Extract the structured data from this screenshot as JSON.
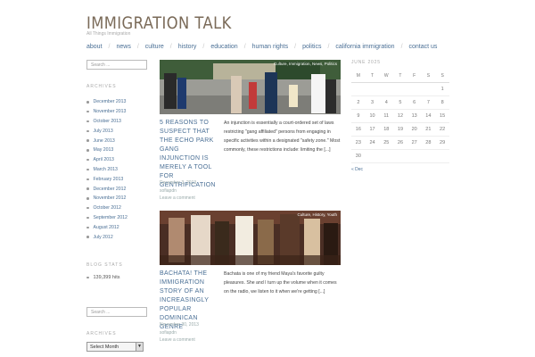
{
  "site": {
    "title": "IMMIGRATION TALK",
    "tagline": "All Things Immigration"
  },
  "nav": [
    "about",
    "news",
    "culture",
    "history",
    "education",
    "human rights",
    "politics",
    "california immigration",
    "contact us"
  ],
  "sidebar": {
    "search_placeholder": "Search ...",
    "archives_title": "ARCHIVES",
    "archives": [
      "December 2013",
      "November 2013",
      "October 2013",
      "July 2013",
      "June 2013",
      "May 2013",
      "April 2013",
      "March 2013",
      "February 2013",
      "December 2012",
      "November 2012",
      "October 2012",
      "September 2012",
      "August 2012",
      "July 2012"
    ],
    "blog_stats_title": "BLOG STATS",
    "hits": "139,399 hits",
    "search2_placeholder": "Search ...",
    "archives2_title": "ARCHIVES",
    "month_select": "Select Month"
  },
  "posts": [
    {
      "image_tags": "Culture, Immigration, News, Politics",
      "title": "5 REASONS TO SUSPECT THAT THE ECHO PARK GANG INJUNCTION IS MERELY A TOOL FOR GENTRIFICATION",
      "date": "December 3, 2013",
      "author": "sofiapdn",
      "comment": "Leave a comment",
      "excerpt": "An injunction is essentially a court-ordered set of laws restricting \"gang affiliated\" persons from engaging in specific activities within a designated \"safety zone.\" Most commonly, these restrictions include: limiting the [...]"
    },
    {
      "image_tags": "Culture, History, Youth",
      "title": "BACHATA! THE IMMIGRATION STORY OF AN INCREASINGLY POPULAR DOMINICAN GENRE",
      "date": "November 30, 2013",
      "author": "sofiapdn",
      "comment": "Leave a comment",
      "excerpt": "Bachata is one of my friend Maya's favorite guilty pleasures. She and I turn up the volume when it comes on the radio, we listen to it when we're getting [...]"
    }
  ],
  "calendar": {
    "caption": "JUNE 2025",
    "days": [
      "M",
      "T",
      "W",
      "T",
      "F",
      "S",
      "S"
    ],
    "weeks": [
      [
        "",
        "",
        "",
        "",
        "",
        "",
        "1"
      ],
      [
        "2",
        "3",
        "4",
        "5",
        "6",
        "7",
        "8"
      ],
      [
        "9",
        "10",
        "11",
        "12",
        "13",
        "14",
        "15"
      ],
      [
        "16",
        "17",
        "18",
        "19",
        "20",
        "21",
        "22"
      ],
      [
        "23",
        "24",
        "25",
        "26",
        "27",
        "28",
        "29"
      ],
      [
        "30",
        "",
        "",
        "",
        "",
        "",
        ""
      ]
    ],
    "prev": "« Dec"
  }
}
